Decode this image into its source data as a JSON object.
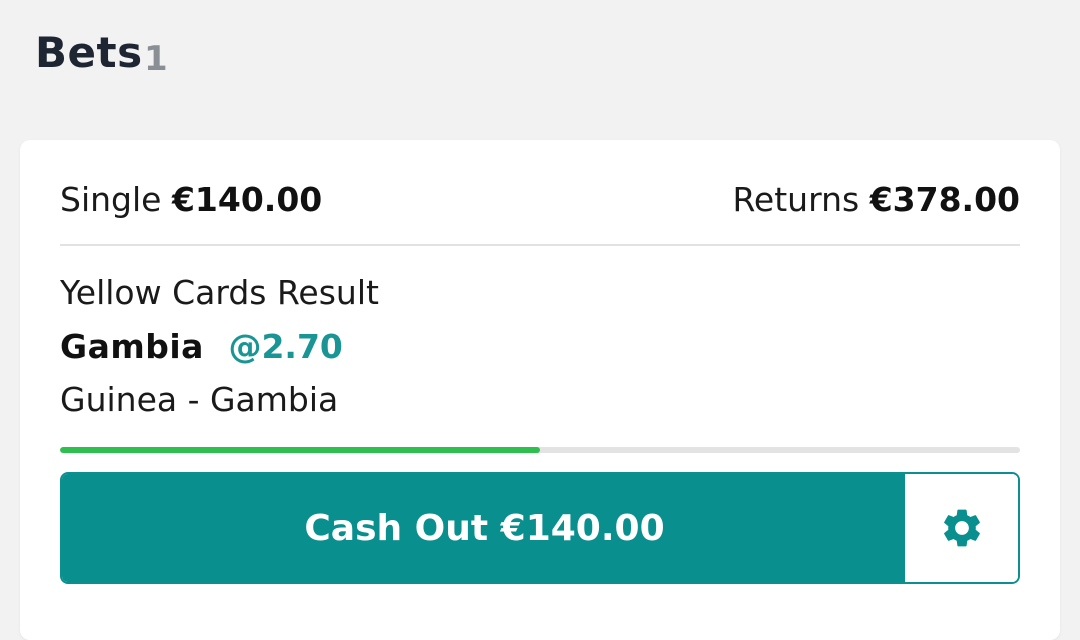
{
  "header": {
    "title": "Bets",
    "count": "1"
  },
  "bet": {
    "type_label": "Single",
    "stake": "€140.00",
    "returns_label": "Returns",
    "returns": "€378.00",
    "market": "Yellow Cards Result",
    "selection": "Gambia",
    "odds": "@2.70",
    "event": "Guinea - Gambia",
    "progress_fraction": 0.5,
    "cashout_label": "Cash Out €140.00",
    "settings_icon": "gear-icon"
  },
  "colors": {
    "accent": "#0a8f8f",
    "progress": "#2fbf4e",
    "odds": "#1a9595"
  }
}
